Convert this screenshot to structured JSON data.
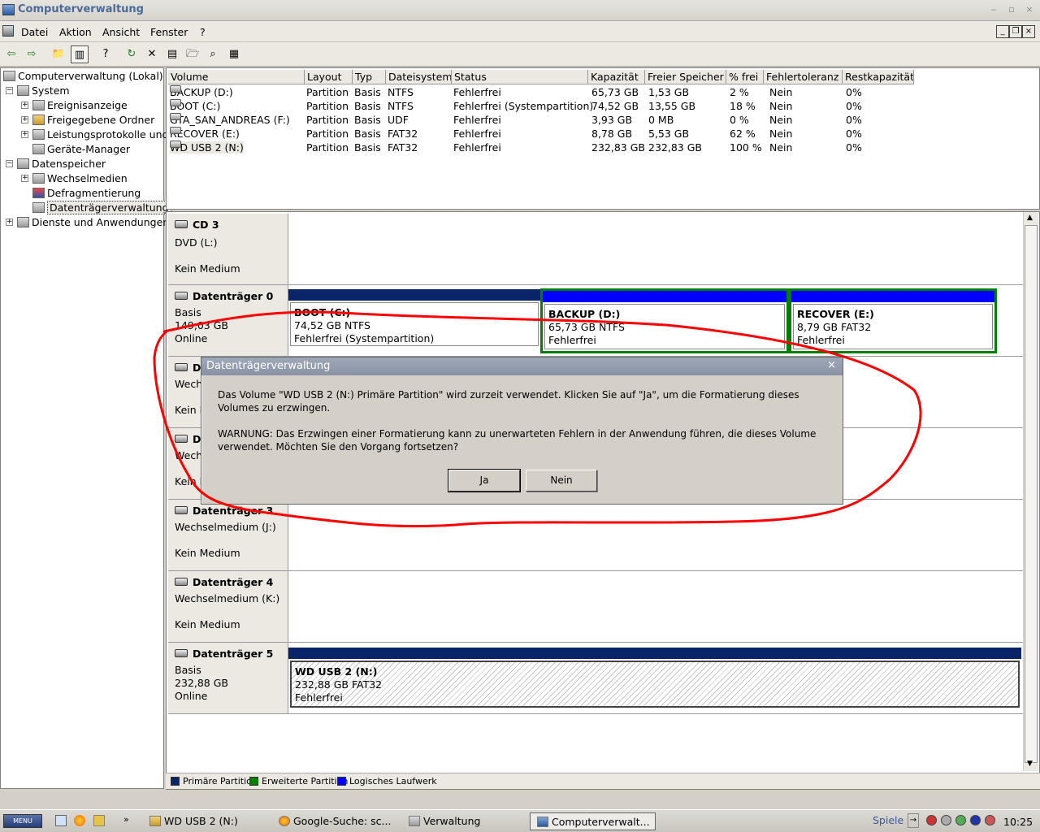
{
  "window": {
    "title": "Computerverwaltung",
    "controls": [
      "‒",
      "▫",
      "×"
    ]
  },
  "menu": [
    "Datei",
    "Aktion",
    "Ansicht",
    "Fenster",
    "?"
  ],
  "tree": {
    "root": "Computerverwaltung (Lokal)",
    "system": "System",
    "ereignis": "Ereignisanzeige",
    "freigabe": "Freigegebene Ordner",
    "leistung": "Leistungsprotokolle und",
    "geraete": "Geräte-Manager",
    "datenspeicher": "Datenspeicher",
    "wechsel": "Wechselmedien",
    "defrag": "Defragmentierung",
    "dtv": "Datenträgerverwaltung",
    "dienste": "Dienste und Anwendungen"
  },
  "volume_table": {
    "headers": [
      "Volume",
      "Layout",
      "Typ",
      "Dateisystem",
      "Status",
      "Kapazität",
      "Freier Speicher",
      "% frei",
      "Fehlertoleranz",
      "Restkapazität"
    ],
    "rows": [
      [
        "BACKUP (D:)",
        "Partition",
        "Basis",
        "NTFS",
        "Fehlerfrei",
        "65,73 GB",
        "1,53 GB",
        "2 %",
        "Nein",
        "0%"
      ],
      [
        "BOOT (C:)",
        "Partition",
        "Basis",
        "NTFS",
        "Fehlerfrei (Systempartition)",
        "74,52 GB",
        "13,55 GB",
        "18 %",
        "Nein",
        "0%"
      ],
      [
        "GTA_SAN_ANDREAS (F:)",
        "Partition",
        "Basis",
        "UDF",
        "Fehlerfrei",
        "3,93 GB",
        "0 MB",
        "0 %",
        "Nein",
        "0%"
      ],
      [
        "RECOVER (E:)",
        "Partition",
        "Basis",
        "FAT32",
        "Fehlerfrei",
        "8,78 GB",
        "5,53 GB",
        "62 %",
        "Nein",
        "0%"
      ],
      [
        "WD USB 2 (N:)",
        "Partition",
        "Basis",
        "FAT32",
        "Fehlerfrei",
        "232,83 GB",
        "232,83 GB",
        "100 %",
        "Nein",
        "0%"
      ]
    ]
  },
  "disks": {
    "cd3": {
      "name": "CD 3",
      "line1": "DVD (L:)",
      "line3": "Kein Medium"
    },
    "d0": {
      "name": "Datenträger 0",
      "line1": "Basis",
      "line2": "149,03 GB",
      "line3": "Online"
    },
    "d1": {
      "name": "D",
      "line1": "Wechs",
      "line3": "Kein M"
    },
    "d2": {
      "name": "D",
      "line1": "Wechs",
      "line3": "Kein M"
    },
    "d3": {
      "name": "Datenträger 3",
      "line1": "Wechselmedium (J:)",
      "line3": "Kein Medium"
    },
    "d4": {
      "name": "Datenträger 4",
      "line1": "Wechselmedium (K:)",
      "line3": "Kein Medium"
    },
    "d5": {
      "name": "Datenträger 5",
      "line1": "Basis",
      "line2": "232,88 GB",
      "line3": "Online"
    }
  },
  "partitions": {
    "boot": {
      "name": "BOOT  (C:)",
      "size": "74,52 GB NTFS",
      "status": "Fehlerfrei (Systempartition)"
    },
    "backup": {
      "name": "BACKUP  (D:)",
      "size": "65,73 GB NTFS",
      "status": "Fehlerfrei"
    },
    "recover": {
      "name": "RECOVER  (E:)",
      "size": "8,79 GB FAT32",
      "status": "Fehlerfrei"
    },
    "wdusb": {
      "name": "WD USB 2  (N:)",
      "size": "232,88 GB FAT32",
      "status": "Fehlerfrei"
    }
  },
  "legend": [
    "Primäre Partition",
    "Erweiterte Partition",
    "Logisches Laufwerk"
  ],
  "colors": {
    "primary": "#0a246a",
    "extended": "#008000",
    "logical": "#0000ff",
    "annotation": "#ff0000"
  },
  "dialog": {
    "title": "Datenträgerverwaltung",
    "close": "×",
    "message1": "Das Volume \"WD USB 2 (N:) Primäre Partition\" wird zurzeit verwendet. Klicken Sie auf \"Ja\", um die Formatierung dieses Volumes zu erzwingen.",
    "message2": "WARNUNG: Das Erzwingen einer Formatierung kann zu unerwarteten Fehlern in der Anwendung führen, die dieses Volume verwendet. Möchten Sie den Vorgang fortsetzen?",
    "yes": "Ja",
    "no": "Nein"
  },
  "taskbar": {
    "start": "MENU",
    "tasks": [
      "WD USB 2 (N:)",
      "Google-Suche: sc...",
      "Verwaltung",
      "Computerverwalt..."
    ],
    "tray_label": "Spiele",
    "clock": "10:25"
  }
}
